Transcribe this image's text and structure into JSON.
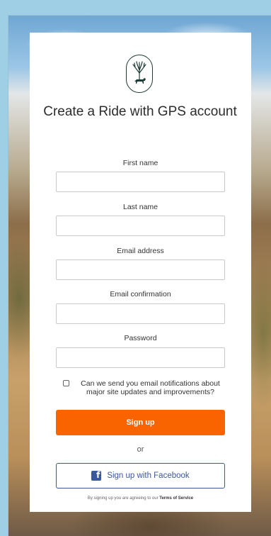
{
  "form": {
    "title": "Create a Ride with GPS account",
    "logo_icon": "tree-horse-logo-icon",
    "fields": {
      "first_name": {
        "label": "First name",
        "value": "",
        "placeholder": ""
      },
      "last_name": {
        "label": "Last name",
        "value": "",
        "placeholder": ""
      },
      "email": {
        "label": "Email address",
        "value": "",
        "placeholder": ""
      },
      "email_confirm": {
        "label": "Email confirmation",
        "value": "",
        "placeholder": ""
      },
      "password": {
        "label": "Password",
        "value": "",
        "placeholder": ""
      }
    },
    "notifications_checkbox": {
      "label": "Can we send you email notifications about major site updates and improvements?",
      "checked": false
    },
    "signup_button": "Sign up",
    "or_text": "or",
    "facebook_button": "Sign up with Facebook",
    "terms_prefix": "By signing up you are agreeing to our",
    "terms_link": "Terms of Service"
  },
  "colors": {
    "accent": "#fa6400",
    "facebook": "#3b5998",
    "logo": "#1d3c36"
  }
}
